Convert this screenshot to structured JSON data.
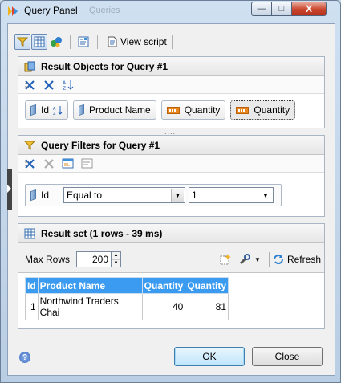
{
  "window": {
    "title": "Query Panel",
    "background_title": "Queries",
    "controls": {
      "minimize": "—",
      "maximize": "□",
      "close": "X"
    }
  },
  "toolbar": {
    "view_script_label": "View script"
  },
  "result_objects": {
    "title": "Result Objects for Query #1",
    "items": [
      {
        "label": "Id",
        "kind": "dimension",
        "sorted": true
      },
      {
        "label": "Product Name",
        "kind": "dimension",
        "sorted": false
      },
      {
        "label": "Quantity",
        "kind": "measure",
        "sorted": false
      },
      {
        "label": "Quantity",
        "kind": "measure",
        "sorted": false,
        "selected": true
      }
    ]
  },
  "query_filters": {
    "title": "Query Filters for Query #1",
    "filter": {
      "object": "Id",
      "operator": "Equal to",
      "value": "1"
    }
  },
  "result_set": {
    "title": "Result set (1 rows - 39 ms)",
    "max_rows_label": "Max Rows",
    "max_rows_value": "200",
    "refresh_label": "Refresh",
    "columns": [
      "Id",
      "Product Name",
      "Quantity",
      "Quantity"
    ],
    "rows": [
      [
        "1",
        "Northwind Traders Chai",
        "40",
        "81"
      ]
    ]
  },
  "footer": {
    "ok_label": "OK",
    "close_label": "Close",
    "help_glyph": "?"
  },
  "colors": {
    "header_blue": "#3a9bf0",
    "measure_orange": "#e8871f"
  }
}
